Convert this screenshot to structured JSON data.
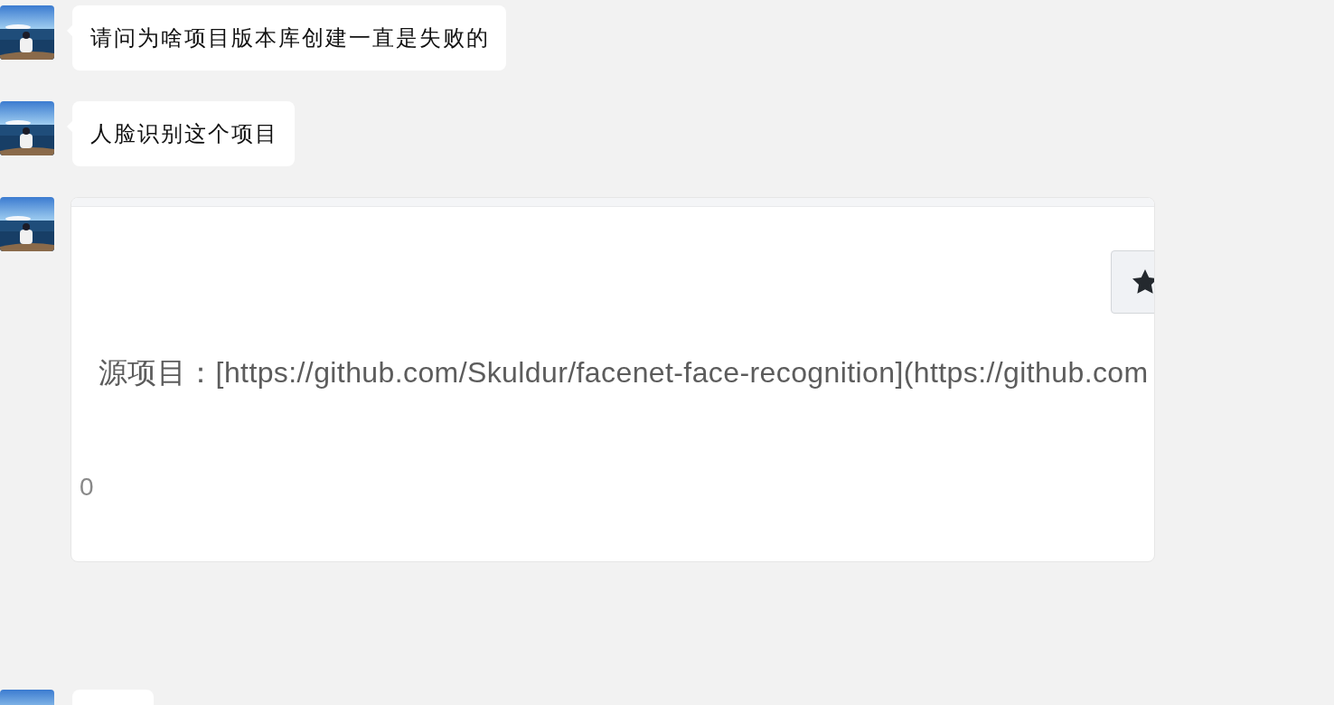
{
  "messages": [
    {
      "kind": "text",
      "text": "请问为啥项目版本库创建一直是失败的"
    },
    {
      "kind": "text",
      "text": "人脸识别这个项目"
    },
    {
      "screenshot": {
        "line": "源项目：[https://github.com/Skuldur/facenet-face-recognition](https://github.com",
        "count": "0"
      }
    },
    {
      "kind": "cut"
    }
  ]
}
